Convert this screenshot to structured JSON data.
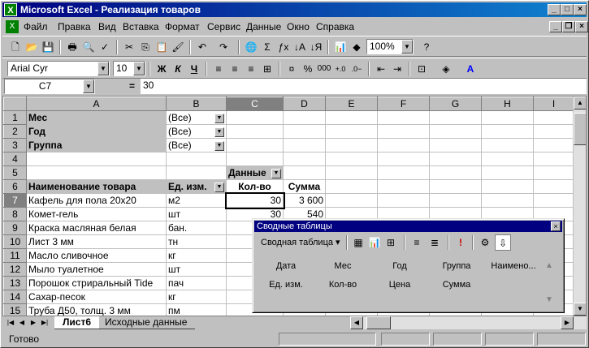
{
  "window": {
    "title": "Microsoft Excel - Реализация товаров",
    "app_icon": "X"
  },
  "menu": [
    "Файл",
    "Правка",
    "Вид",
    "Вставка",
    "Формат",
    "Сервис",
    "Данные",
    "Окно",
    "Справка"
  ],
  "toolbar1": {
    "zoom": "100%"
  },
  "toolbar2": {
    "font": "Arial Cyr",
    "size": "10",
    "bold": "Ж",
    "italic": "К",
    "underline": "Ч",
    "percent": "%",
    "thousands": "000"
  },
  "formula": {
    "cell_ref": "C7",
    "eq": "=",
    "value": "30"
  },
  "columns": [
    "A",
    "B",
    "C",
    "D",
    "E",
    "F",
    "G",
    "H",
    "I"
  ],
  "rows": [
    {
      "n": "1",
      "a": "Мес",
      "b": "(Все)",
      "c": "",
      "d": ""
    },
    {
      "n": "2",
      "a": "Год",
      "b": "(Все)",
      "c": "",
      "d": ""
    },
    {
      "n": "3",
      "a": "Группа",
      "b": "(Все)",
      "c": "",
      "d": ""
    },
    {
      "n": "4",
      "a": "",
      "b": "",
      "c": "",
      "d": ""
    },
    {
      "n": "5",
      "a": "",
      "b": "",
      "c": "Данные",
      "d": ""
    },
    {
      "n": "6",
      "a": "Наименование товара",
      "b": "Ед. изм.",
      "c": "Кол-во",
      "d": "Сумма"
    },
    {
      "n": "7",
      "a": "Кафель для пола 20х20",
      "b": "м2",
      "c": "30",
      "d": "3 600"
    },
    {
      "n": "8",
      "a": "Комет-гель",
      "b": "шт",
      "c": "30",
      "d": "540"
    },
    {
      "n": "9",
      "a": "Краска масляная белая",
      "b": "бан.",
      "c": "",
      "d": ""
    },
    {
      "n": "10",
      "a": "Лист 3 мм",
      "b": "тн",
      "c": "",
      "d": ""
    },
    {
      "n": "11",
      "a": "Масло сливочное",
      "b": "кг",
      "c": "",
      "d": ""
    },
    {
      "n": "12",
      "a": "Мыло туалетное",
      "b": "шт",
      "c": "",
      "d": ""
    },
    {
      "n": "13",
      "a": "Порошок стриральный Tide",
      "b": "пач",
      "c": "",
      "d": ""
    },
    {
      "n": "14",
      "a": "Сахар-песок",
      "b": "кг",
      "c": "",
      "d": ""
    },
    {
      "n": "15",
      "a": "Труба Д50, толщ. 3 мм",
      "b": "пм",
      "c": "",
      "d": ""
    }
  ],
  "tabs": {
    "active": "Лист6",
    "other": "Исходные данные"
  },
  "status": "Готово",
  "pivot_toolbar": {
    "title": "Сводные таблицы",
    "menu_label": "Сводная таблица",
    "fields_row1": [
      "Дата",
      "Мес",
      "Год",
      "Группа",
      "Наимено..."
    ],
    "fields_row2": [
      "Ед. изм.",
      "Кол-во",
      "Цена",
      "Сумма"
    ]
  }
}
